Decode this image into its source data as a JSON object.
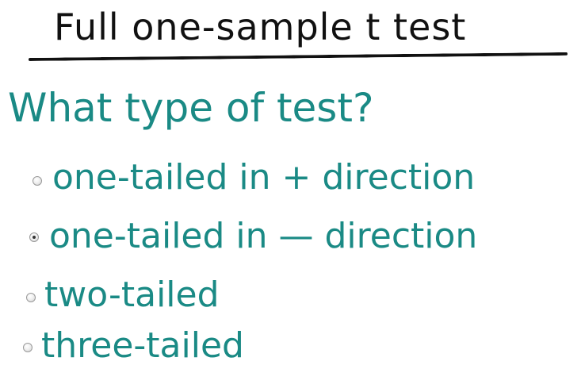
{
  "title": "Full one-sample t test",
  "question": "What type of test?",
  "options": [
    {
      "label": "one-tailed in + direction",
      "selected": false
    },
    {
      "label": "one-tailed in — direction",
      "selected": true
    },
    {
      "label": "two-tailed",
      "selected": false
    },
    {
      "label": "three-tailed",
      "selected": false
    }
  ],
  "colors": {
    "title": "#111111",
    "handwriting": "#1a8a85"
  }
}
